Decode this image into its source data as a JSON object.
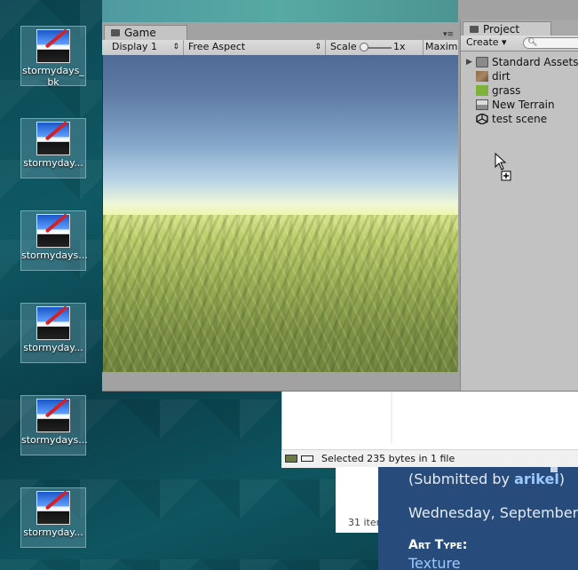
{
  "desktop": {
    "icons": [
      {
        "label": "stormydays_\nbk",
        "l1": "stormydays_",
        "l2": "bk"
      },
      {
        "label": "stormyday...",
        "l1": "stormyday...",
        "l2": ""
      },
      {
        "label": "stormydays...",
        "l1": "stormydays...",
        "l2": ""
      },
      {
        "label": "stormyday...",
        "l1": "stormyday...",
        "l2": ""
      },
      {
        "label": "stormydays...",
        "l1": "stormydays...",
        "l2": ""
      },
      {
        "label": "stormyday...",
        "l1": "stormyday...",
        "l2": ""
      }
    ]
  },
  "unity": {
    "game_tab": "Game",
    "game_tab_menu": "▾≡",
    "toolbar": {
      "display": "Display 1",
      "aspect": "Free Aspect",
      "scale_label": "Scale",
      "scale_value": "1x",
      "maximize": "Maximi"
    },
    "project": {
      "tab": "Project",
      "create": "Create ▾",
      "search_placeholder": "",
      "items": [
        {
          "name": "Standard Assets",
          "icon": "folder-icon",
          "expandable": true
        },
        {
          "name": "dirt",
          "icon": "texture-icon",
          "expandable": false
        },
        {
          "name": "grass",
          "icon": "texture-icon",
          "expandable": false
        },
        {
          "name": "New Terrain",
          "icon": "terrain-icon",
          "expandable": false
        },
        {
          "name": "test scene",
          "icon": "unity-scene-icon",
          "expandable": false
        }
      ]
    }
  },
  "explorer": {
    "status": "Selected 235 bytes in 1 file",
    "items_count": "31 iter"
  },
  "webpage": {
    "submitted_prefix": "(Submitted by ",
    "submitted_user": "arikel",
    "submitted_suffix": ")",
    "date": "Wednesday, September",
    "art_type_label": "Art Type:",
    "art_type_value": "Texture"
  },
  "colors": {
    "desktop_teal": "#0f4a55",
    "unity_panel": "#a2a2a2",
    "web_panel": "#274c7b",
    "link": "#9cc9ff"
  }
}
